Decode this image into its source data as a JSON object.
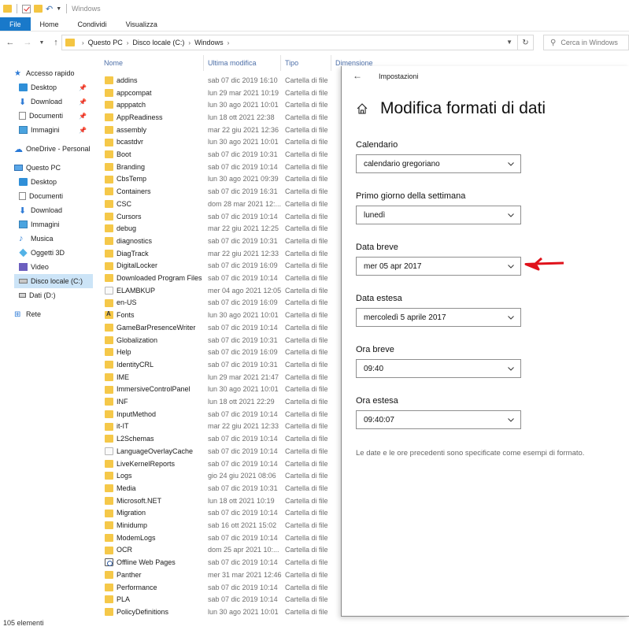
{
  "window": {
    "title": "Windows"
  },
  "ribbon": {
    "tabs": [
      "File",
      "Home",
      "Condividi",
      "Visualizza"
    ]
  },
  "address": {
    "crumbs": [
      "Questo PC",
      "Disco locale (C:)",
      "Windows"
    ],
    "search_placeholder": "Cerca in Windows"
  },
  "nav": {
    "items": [
      {
        "label": "Accesso rapido",
        "icon": "star-icon"
      },
      {
        "label": "Desktop",
        "icon": "desktop-icon",
        "pinned": true
      },
      {
        "label": "Download",
        "icon": "download-icon",
        "pinned": true
      },
      {
        "label": "Documenti",
        "icon": "documents-icon",
        "pinned": true
      },
      {
        "label": "Immagini",
        "icon": "images-icon",
        "pinned": true
      },
      {
        "label": "OneDrive - Personal",
        "icon": "cloud-icon"
      },
      {
        "label": "Questo PC",
        "icon": "pc-icon"
      },
      {
        "label": "Desktop",
        "icon": "desktop-icon"
      },
      {
        "label": "Documenti",
        "icon": "documents-icon"
      },
      {
        "label": "Download",
        "icon": "download-icon"
      },
      {
        "label": "Immagini",
        "icon": "images-icon"
      },
      {
        "label": "Musica",
        "icon": "music-icon"
      },
      {
        "label": "Oggetti 3D",
        "icon": "objects3d-icon"
      },
      {
        "label": "Video",
        "icon": "video-icon"
      },
      {
        "label": "Disco locale (C:)",
        "icon": "drive-icon",
        "selected": true
      },
      {
        "label": "Dati (D:)",
        "icon": "usb-drive-icon"
      },
      {
        "label": "Rete",
        "icon": "network-icon"
      }
    ]
  },
  "list": {
    "columns": [
      "Nome",
      "Ultima modifica",
      "Tipo",
      "Dimensione"
    ],
    "rows": [
      {
        "name": "addins",
        "date": "sab 07 dic 2019 16:10",
        "type": "Cartella di file"
      },
      {
        "name": "appcompat",
        "date": "lun 29 mar 2021 10:19",
        "type": "Cartella di file"
      },
      {
        "name": "apppatch",
        "date": "lun 30 ago 2021 10:01",
        "type": "Cartella di file"
      },
      {
        "name": "AppReadiness",
        "date": "lun 18 ott 2021 22:38",
        "type": "Cartella di file"
      },
      {
        "name": "assembly",
        "date": "mar 22 giu 2021 12:36",
        "type": "Cartella di file"
      },
      {
        "name": "bcastdvr",
        "date": "lun 30 ago 2021 10:01",
        "type": "Cartella di file"
      },
      {
        "name": "Boot",
        "date": "sab 07 dic 2019 10:31",
        "type": "Cartella di file"
      },
      {
        "name": "Branding",
        "date": "sab 07 dic 2019 10:14",
        "type": "Cartella di file"
      },
      {
        "name": "CbsTemp",
        "date": "lun 30 ago 2021 09:39",
        "type": "Cartella di file"
      },
      {
        "name": "Containers",
        "date": "sab 07 dic 2019 16:31",
        "type": "Cartella di file"
      },
      {
        "name": "CSC",
        "date": "dom 28 mar 2021 12:...",
        "type": "Cartella di file"
      },
      {
        "name": "Cursors",
        "date": "sab 07 dic 2019 10:14",
        "type": "Cartella di file"
      },
      {
        "name": "debug",
        "date": "mar 22 giu 2021 12:25",
        "type": "Cartella di file"
      },
      {
        "name": "diagnostics",
        "date": "sab 07 dic 2019 10:31",
        "type": "Cartella di file"
      },
      {
        "name": "DiagTrack",
        "date": "mar 22 giu 2021 12:33",
        "type": "Cartella di file"
      },
      {
        "name": "DigitalLocker",
        "date": "sab 07 dic 2019 16:09",
        "type": "Cartella di file"
      },
      {
        "name": "Downloaded Program Files",
        "date": "sab 07 dic 2019 10:14",
        "type": "Cartella di file"
      },
      {
        "name": "ELAMBKUP",
        "date": "mer 04 ago 2021 12:05",
        "type": "Cartella di file",
        "icon": "page"
      },
      {
        "name": "en-US",
        "date": "sab 07 dic 2019 16:09",
        "type": "Cartella di file"
      },
      {
        "name": "Fonts",
        "date": "lun 30 ago 2021 10:01",
        "type": "Cartella di file",
        "icon": "font"
      },
      {
        "name": "GameBarPresenceWriter",
        "date": "sab 07 dic 2019 10:14",
        "type": "Cartella di file"
      },
      {
        "name": "Globalization",
        "date": "sab 07 dic 2019 10:31",
        "type": "Cartella di file"
      },
      {
        "name": "Help",
        "date": "sab 07 dic 2019 16:09",
        "type": "Cartella di file"
      },
      {
        "name": "IdentityCRL",
        "date": "sab 07 dic 2019 10:31",
        "type": "Cartella di file"
      },
      {
        "name": "IME",
        "date": "lun 29 mar 2021 21:47",
        "type": "Cartella di file"
      },
      {
        "name": "ImmersiveControlPanel",
        "date": "lun 30 ago 2021 10:01",
        "type": "Cartella di file"
      },
      {
        "name": "INF",
        "date": "lun 18 ott 2021 22:29",
        "type": "Cartella di file"
      },
      {
        "name": "InputMethod",
        "date": "sab 07 dic 2019 10:14",
        "type": "Cartella di file"
      },
      {
        "name": "it-IT",
        "date": "mar 22 giu 2021 12:33",
        "type": "Cartella di file"
      },
      {
        "name": "L2Schemas",
        "date": "sab 07 dic 2019 10:14",
        "type": "Cartella di file"
      },
      {
        "name": "LanguageOverlayCache",
        "date": "sab 07 dic 2019 10:14",
        "type": "Cartella di file",
        "icon": "page"
      },
      {
        "name": "LiveKernelReports",
        "date": "sab 07 dic 2019 10:14",
        "type": "Cartella di file"
      },
      {
        "name": "Logs",
        "date": "gio 24 giu 2021 08:06",
        "type": "Cartella di file"
      },
      {
        "name": "Media",
        "date": "sab 07 dic 2019 10:31",
        "type": "Cartella di file"
      },
      {
        "name": "Microsoft.NET",
        "date": "lun 18 ott 2021 10:19",
        "type": "Cartella di file"
      },
      {
        "name": "Migration",
        "date": "sab 07 dic 2019 10:14",
        "type": "Cartella di file"
      },
      {
        "name": "Minidump",
        "date": "sab 16 ott 2021 15:02",
        "type": "Cartella di file"
      },
      {
        "name": "ModemLogs",
        "date": "sab 07 dic 2019 10:14",
        "type": "Cartella di file"
      },
      {
        "name": "OCR",
        "date": "dom 25 apr 2021 10:...",
        "type": "Cartella di file"
      },
      {
        "name": "Offline Web Pages",
        "date": "sab 07 dic 2019 10:14",
        "type": "Cartella di file",
        "icon": "web"
      },
      {
        "name": "Panther",
        "date": "mer 31 mar 2021 12:46",
        "type": "Cartella di file"
      },
      {
        "name": "Performance",
        "date": "sab 07 dic 2019 10:14",
        "type": "Cartella di file"
      },
      {
        "name": "PLA",
        "date": "sab 07 dic 2019 10:14",
        "type": "Cartella di file"
      },
      {
        "name": "PolicyDefinitions",
        "date": "lun 30 ago 2021 10:01",
        "type": "Cartella di file"
      }
    ]
  },
  "status": {
    "count": "105 elementi"
  },
  "settings": {
    "app_title": "Impostazioni",
    "page_title": "Modifica formati di dati",
    "fields": [
      {
        "label": "Calendario",
        "value": "calendario gregoriano"
      },
      {
        "label": "Primo giorno della settimana",
        "value": "lunedì"
      },
      {
        "label": "Data breve",
        "value": "mer 05 apr 2017"
      },
      {
        "label": "Data estesa",
        "value": "mercoledì 5 aprile 2017"
      },
      {
        "label": "Ora breve",
        "value": "09:40"
      },
      {
        "label": "Ora estesa",
        "value": "09:40:07"
      }
    ],
    "footnote": "Le date e le ore precedenti sono specificate come esempi di formato.",
    "highlight_color": "#e0121b"
  }
}
